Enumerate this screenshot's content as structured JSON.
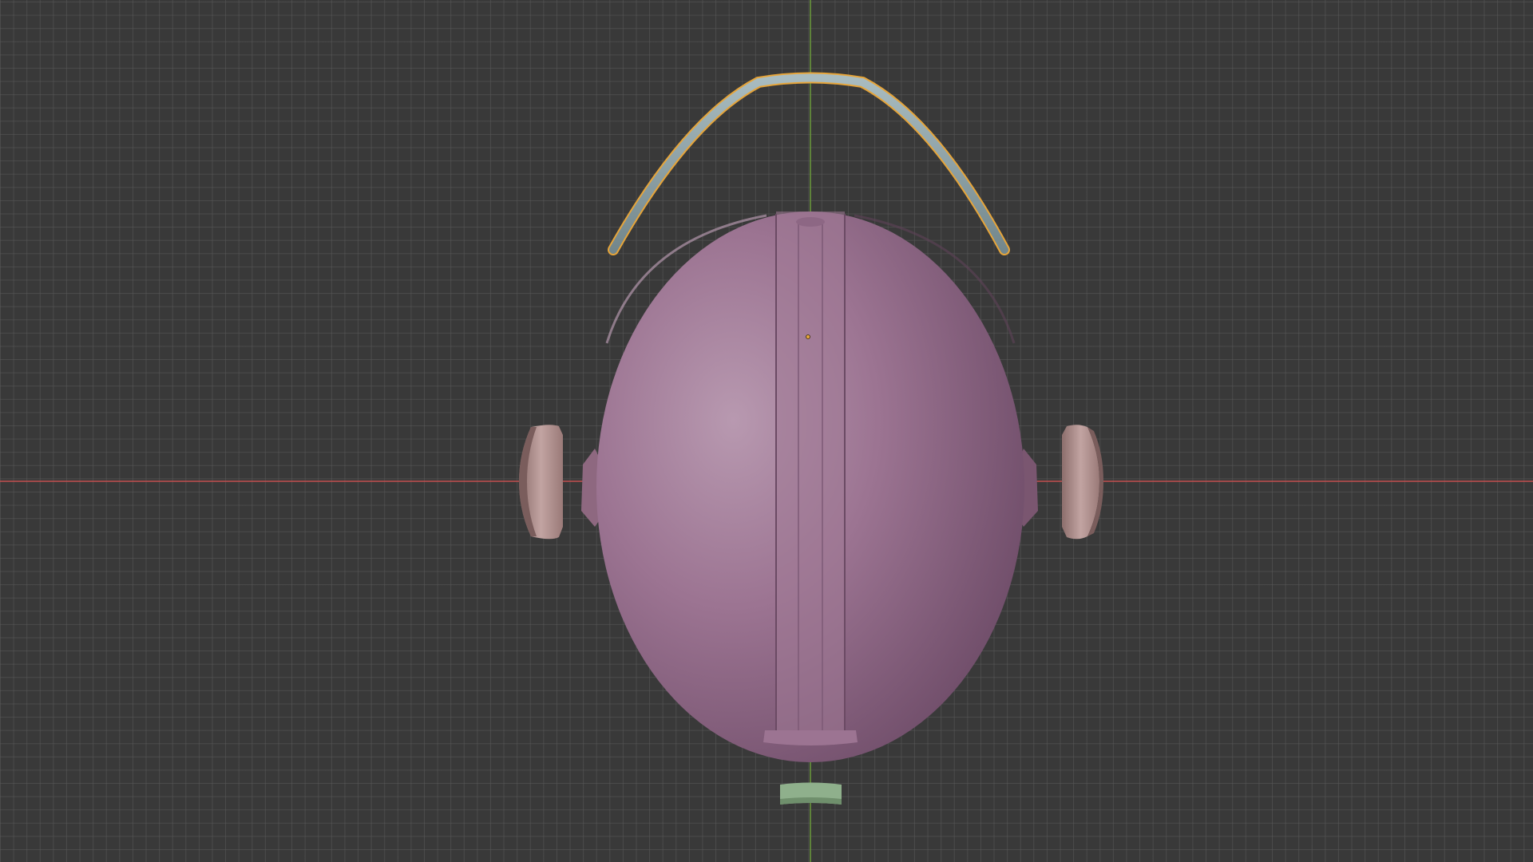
{
  "viewport": {
    "view": "top-orthographic",
    "background_color": "#393939",
    "grid_color": "#5a5a5a",
    "x_axis_color": "#c24f4f",
    "y_axis_color": "#6a9a3a"
  },
  "scene": {
    "objects": [
      {
        "name": "helmet-shell",
        "color": "#a4799a",
        "selected": false
      },
      {
        "name": "headband",
        "color": "#8fa3a8",
        "selected": true,
        "outline_color": "#e6a53a"
      },
      {
        "name": "left-earcup",
        "color": "#b89896",
        "selected": false
      },
      {
        "name": "right-earcup",
        "color": "#b89896",
        "selected": false
      },
      {
        "name": "front-strap",
        "color": "#8fb08c",
        "selected": false
      }
    ],
    "origin_marker_color": "#e6a53a"
  }
}
